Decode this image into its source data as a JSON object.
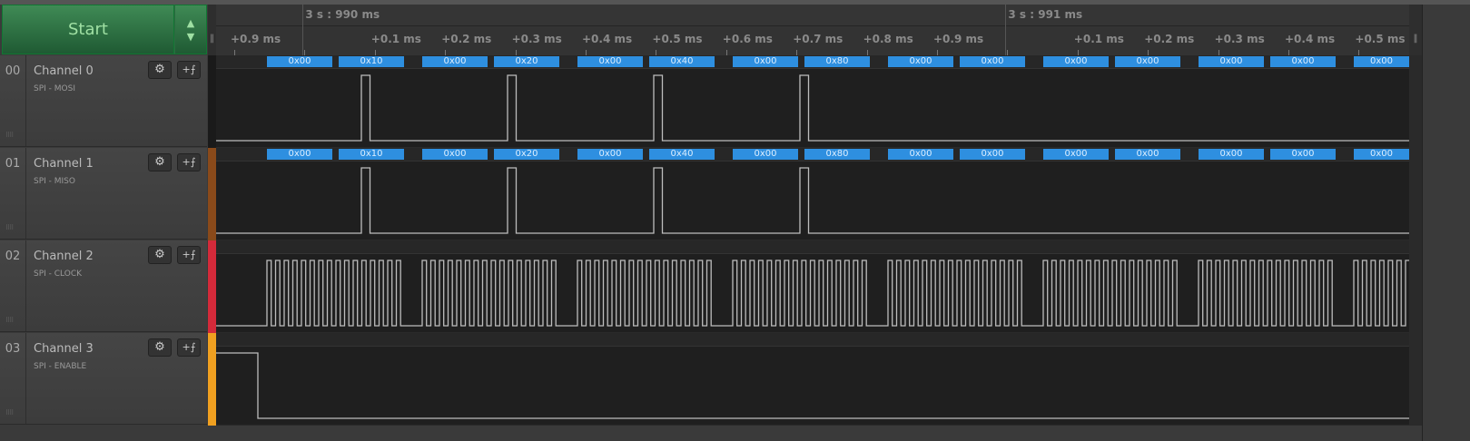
{
  "controls": {
    "start_label": "Start",
    "up_icon": "▲",
    "down_icon": "▼"
  },
  "timeline": {
    "major": [
      {
        "label": "3 s : 990 ms",
        "tick_index": 1
      },
      {
        "label": "3 s : 991 ms",
        "tick_index": 11
      }
    ],
    "ticks": [
      "+0.9 ms",
      "",
      "+0.1 ms",
      "+0.2 ms",
      "+0.3 ms",
      "+0.4 ms",
      "+0.5 ms",
      "+0.6 ms",
      "+0.7 ms",
      "+0.8 ms",
      "+0.9 ms",
      "",
      "+0.1 ms",
      "+0.2 ms",
      "+0.3 ms",
      "+0.4 ms",
      "+0.5 ms"
    ]
  },
  "channels": [
    {
      "num": "00",
      "name": "Channel 0",
      "sub": "SPI - MOSI",
      "color": "#1a1a1a",
      "kind": "data",
      "decoded": [
        "0x00",
        "0x10",
        "0x00",
        "0x20",
        "0x00",
        "0x40",
        "0x00",
        "0x80",
        "0x00",
        "0x00",
        "0x00",
        "0x00",
        "0x00",
        "0x00",
        "0x00"
      ]
    },
    {
      "num": "01",
      "name": "Channel 1",
      "sub": "SPI - MISO",
      "color": "#8a4a1a",
      "kind": "data",
      "decoded": [
        "0x00",
        "0x10",
        "0x00",
        "0x20",
        "0x00",
        "0x40",
        "0x00",
        "0x80",
        "0x00",
        "0x00",
        "0x00",
        "0x00",
        "0x00",
        "0x00",
        "0x00"
      ]
    },
    {
      "num": "02",
      "name": "Channel 2",
      "sub": "SPI - CLOCK",
      "color": "#d42a3a",
      "kind": "clock",
      "decoded": []
    },
    {
      "num": "03",
      "name": "Channel 3",
      "sub": "SPI - ENABLE",
      "color": "#f0a020",
      "kind": "enable",
      "decoded": []
    }
  ],
  "icons": {
    "settings": "⚙",
    "trigger": "+⨍",
    "grip": "⠿⠿"
  }
}
